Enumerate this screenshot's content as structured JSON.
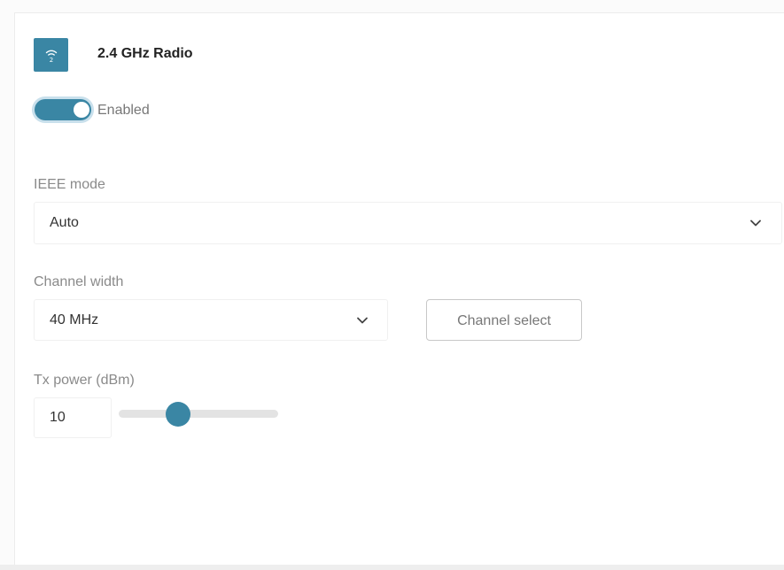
{
  "radio": {
    "title": "2.4 GHz Radio",
    "icon": "wifi-icon",
    "accent_color": "#3a86a4"
  },
  "enable_toggle": {
    "label": "Enabled",
    "on": true
  },
  "ieee_mode": {
    "label": "IEEE mode",
    "value": "Auto"
  },
  "channel_width": {
    "label": "Channel width",
    "value": "40 MHz"
  },
  "channel_select": {
    "label": "Channel select"
  },
  "tx_power": {
    "label": "Tx power (dBm)",
    "value": "10",
    "slider_fraction": 0.35
  }
}
